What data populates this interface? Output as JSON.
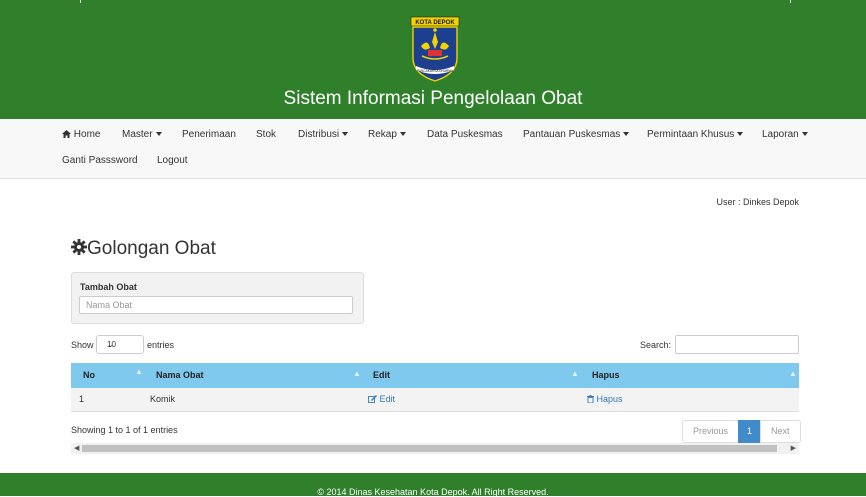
{
  "header": {
    "logo_top_text": "KOTA DEPOK",
    "logo_ribbon_text": "PANCAKARSA DHARMA",
    "app_title": "Sistem Informasi Pengelolaan Obat",
    "colors": {
      "header_bg": "#2f7f2b",
      "table_header": "#7fc9ef",
      "link": "#337ab7"
    }
  },
  "nav": {
    "items": [
      {
        "label": "Home",
        "icon": "home-icon"
      },
      {
        "label": "Master",
        "dropdown": true
      },
      {
        "label": "Penerimaan"
      },
      {
        "label": "Stok"
      },
      {
        "label": "Distribusi",
        "dropdown": true
      },
      {
        "label": "Rekap",
        "dropdown": true
      },
      {
        "label": "Data Puskesmas"
      },
      {
        "label": "Pantauan Puskesmas",
        "dropdown": true
      },
      {
        "label": "Permintaan Khusus",
        "dropdown": true
      },
      {
        "label": "Laporan",
        "dropdown": true
      },
      {
        "label": "Ganti Passsword"
      },
      {
        "label": "Logout"
      }
    ]
  },
  "user_info": "User : Dinkes Depok",
  "page_title": "Golongan Obat",
  "form": {
    "label": "Tambah Obat",
    "placeholder": "Nama Obat"
  },
  "datatable": {
    "show_label": "Show",
    "length_value": "10",
    "entries_label": "entries",
    "search_label": "Search:",
    "columns": [
      "No",
      "Nama Obat",
      "Edit",
      "Hapus"
    ],
    "rows": [
      {
        "no": "1",
        "nama": "Komik",
        "edit": "Edit",
        "hapus": "Hapus"
      }
    ],
    "info": "Showing 1 to 1 of 1 entries",
    "pagination": {
      "previous": "Previous",
      "current": "1",
      "next": "Next"
    }
  },
  "footer": "© 2014 Dinas Kesehatan Kota Depok. All Right Reserved."
}
